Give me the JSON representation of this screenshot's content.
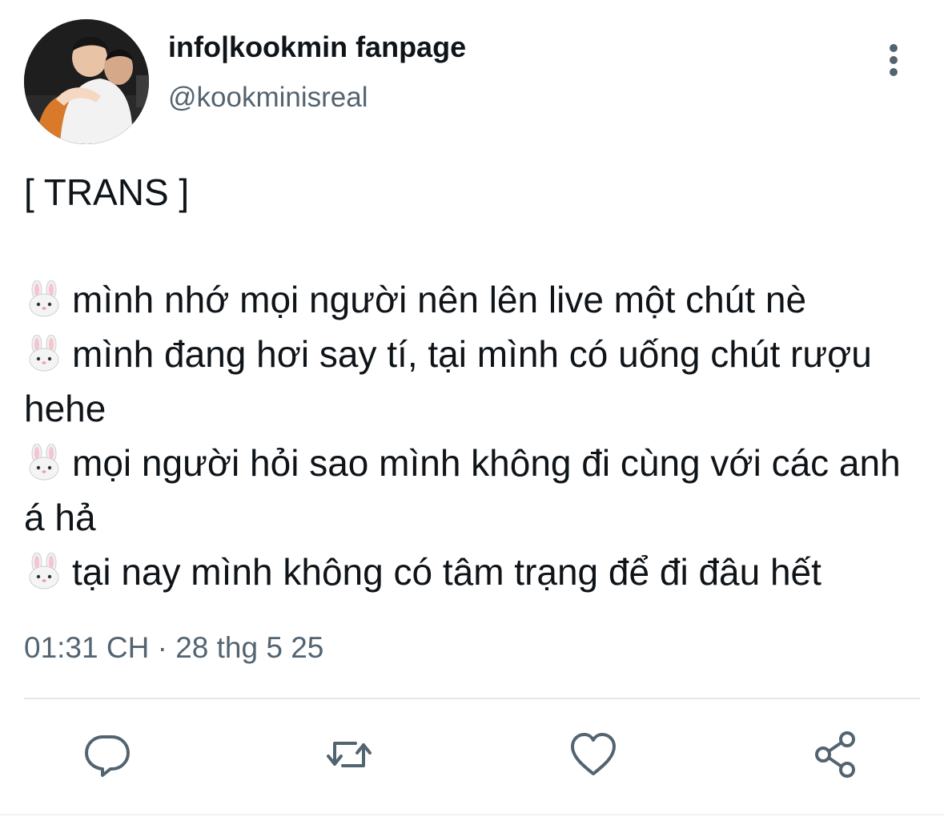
{
  "author": {
    "display_name": "info|kookmin fanpage",
    "handle": "@kookminisreal"
  },
  "tweet": {
    "header_line": "[ TRANS ]",
    "items": [
      {
        "emoji": "rabbit-face",
        "text": "mình nhớ mọi người nên lên live một chút nè"
      },
      {
        "emoji": "rabbit-face",
        "text": "mình đang hơi say tí, tại mình có uống chút rượu hehe"
      },
      {
        "emoji": "rabbit-face",
        "text": "mọi người hỏi sao mình không đi cùng với các anh á hả"
      },
      {
        "emoji": "rabbit-face",
        "text": "tại nay mình không có tâm trạng để đi đâu hết"
      }
    ]
  },
  "meta": {
    "timestamp": "01:31 CH · 28 thg 5 25"
  },
  "actions": {
    "reply": "reply-icon",
    "retweet": "retweet-icon",
    "like": "heart-icon",
    "share": "share-icon"
  },
  "colors": {
    "text_primary": "#0f1419",
    "text_secondary": "#536471",
    "icon": "#536471",
    "divider": "#e3e7ea"
  }
}
